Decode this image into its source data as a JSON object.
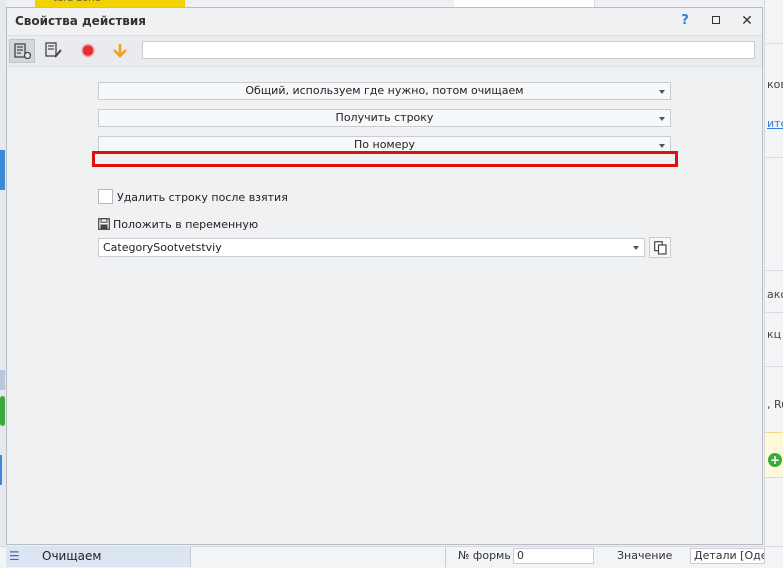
{
  "background": {
    "top_tab_text": "tera-zone",
    "right_fragments": [
      "ков",
      "ите",
      "ако",
      "кц",
      ", Ru"
    ],
    "list_item_label": "Очищаем",
    "bottom_label_form": "№ формы",
    "bottom_field_form": "0",
    "bottom_label_value": "Значение",
    "bottom_field_value": "Детали [Одежда]"
  },
  "dialog": {
    "title": "Свойства действия",
    "help_label": "?",
    "close_label": "✕",
    "toolbar": {
      "input_value": ""
    },
    "combo_list": "Общий, используем где нужно, потом очищаем",
    "combo_operation": "Получить строку",
    "combo_mode": "По номеру",
    "delete_after_take_label": "Удалить строку после взятия",
    "save_to_variable_label": "Положить в переменную",
    "variable_value": "CategorySootvetstviy"
  },
  "colors": {
    "accent_blue": "#2f7fd8",
    "record_red": "#e03030",
    "arrow_orange": "#f0a020",
    "highlight_red": "#e01010"
  },
  "icons": [
    "properties-icon",
    "edit-icon",
    "record-icon",
    "arrow-down-icon",
    "save-icon",
    "copy-icon",
    "list-icon",
    "plus-icon"
  ]
}
